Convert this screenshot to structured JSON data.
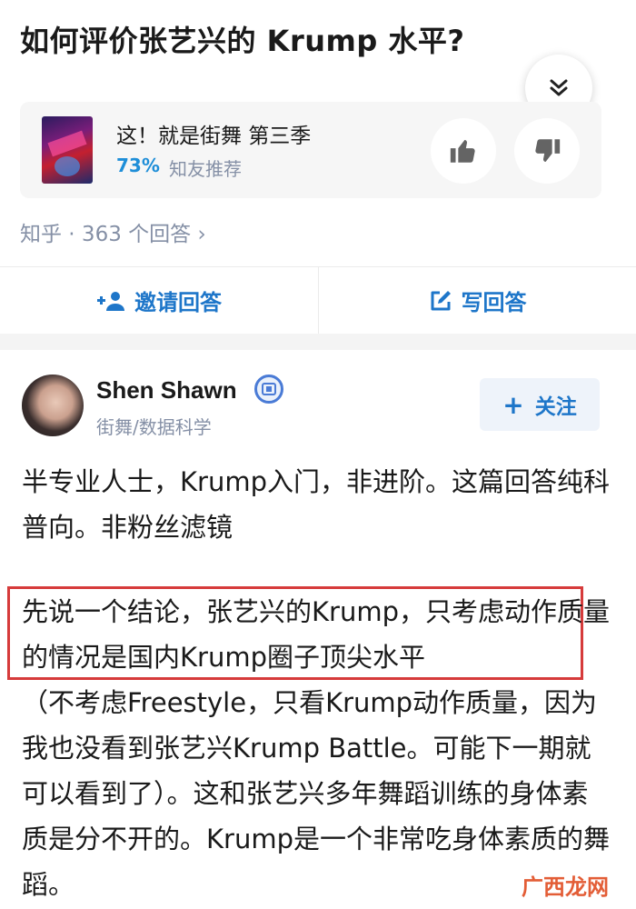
{
  "question": {
    "title": "如何评价张艺兴的 Krump 水平?"
  },
  "card": {
    "title": "这！就是街舞 第三季",
    "score": "73%",
    "score_label": "知友推荐"
  },
  "meta": {
    "text": "知乎 · 363 个回答 ›"
  },
  "actions": {
    "invite": "邀请回答",
    "write": "写回答"
  },
  "author": {
    "name": "Shen Shawn",
    "bio": "街舞/数据科学",
    "follow_label": "关注"
  },
  "answer": {
    "p1": "半专业人士，Krump入门，非进阶。这篇回答纯科普向。非粉丝滤镜",
    "p2": "先说一个结论，张艺兴的Krump，只考虑动作质量的情况是国内Krump圈子顶尖水平",
    "p3": "（不考虑Freestyle，只看Krump动作质量，因为我也没看到张艺兴Krump Battle。可能下一期就可以看到了）。这和张艺兴多年舞蹈训练的身体素质是分不开的。Krump是一个非常吃身体素质的舞蹈。"
  },
  "watermark": {
    "text": "广西龙网"
  },
  "colors": {
    "accent": "#1e76c9",
    "highlight_border": "#d63b3b",
    "muted": "#8590a6"
  }
}
